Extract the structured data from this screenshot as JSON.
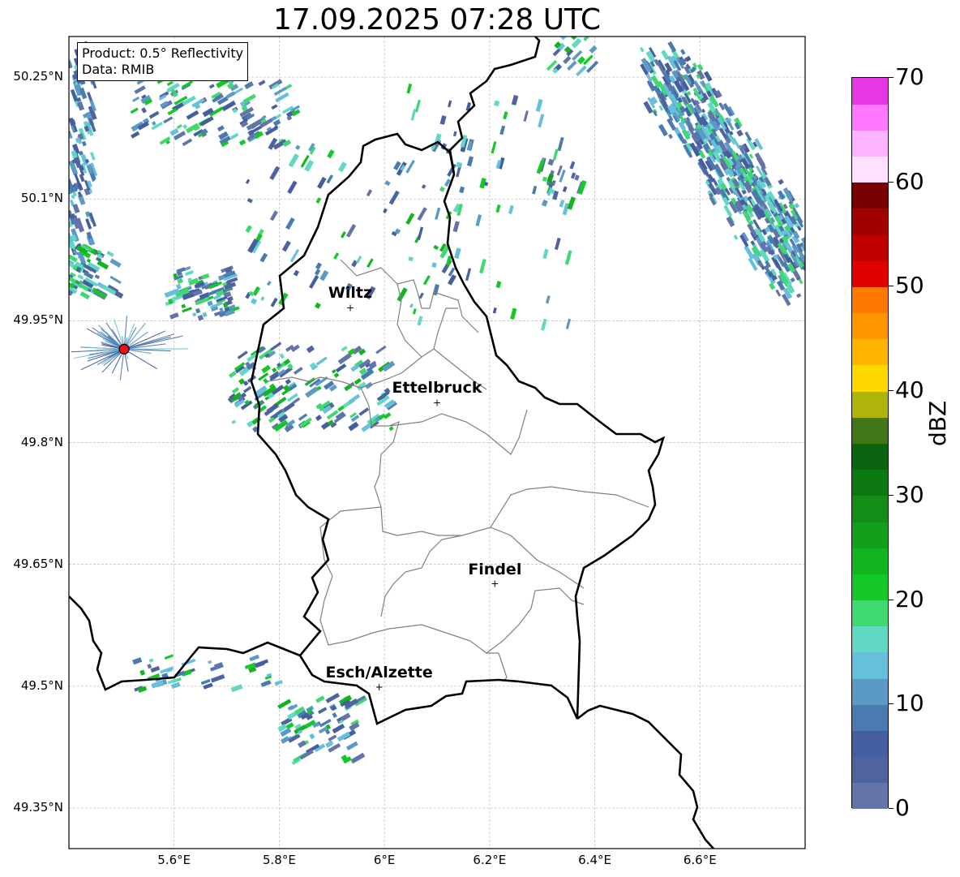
{
  "title": "17.09.2025 07:28 UTC",
  "info_box": {
    "product": "Product: 0.5° Reflectivity",
    "data": "Data: RMIB"
  },
  "latitude_ticks": [
    {
      "value": 50.25,
      "label": "50.25°N"
    },
    {
      "value": 50.1,
      "label": "50.1°N"
    },
    {
      "value": 49.95,
      "label": "49.95°N"
    },
    {
      "value": 49.8,
      "label": "49.8°N"
    },
    {
      "value": 49.65,
      "label": "49.65°N"
    },
    {
      "value": 49.5,
      "label": "49.5°N"
    },
    {
      "value": 49.35,
      "label": "49.35°N"
    }
  ],
  "longitude_ticks": [
    {
      "value": 5.6,
      "label": "5.6°E"
    },
    {
      "value": 5.8,
      "label": "5.8°E"
    },
    {
      "value": 6.0,
      "label": "6°E"
    },
    {
      "value": 6.2,
      "label": "6.2°E"
    },
    {
      "value": 6.4,
      "label": "6.4°E"
    },
    {
      "value": 6.6,
      "label": "6.6°E"
    }
  ],
  "extent": {
    "lon_min": 5.4,
    "lon_max": 6.8,
    "lat_min": 49.3,
    "lat_max": 50.3
  },
  "cities": [
    {
      "name": "Wiltz",
      "lon": 5.935,
      "lat": 49.967
    },
    {
      "name": "Ettelbruck",
      "lon": 6.1,
      "lat": 49.85
    },
    {
      "name": "Findel",
      "lon": 6.21,
      "lat": 49.627
    },
    {
      "name": "Esch/Alzette",
      "lon": 5.99,
      "lat": 49.5
    }
  ],
  "radar_site": {
    "lon": 5.505,
    "lat": 49.915
  },
  "colorbar": {
    "label": "dBZ",
    "ticks": [
      {
        "value": 0,
        "label": "0"
      },
      {
        "value": 10,
        "label": "10"
      },
      {
        "value": 20,
        "label": "20"
      },
      {
        "value": 30,
        "label": "30"
      },
      {
        "value": 40,
        "label": "40"
      },
      {
        "value": 50,
        "label": "50"
      },
      {
        "value": 60,
        "label": "60"
      },
      {
        "value": 70,
        "label": "70"
      }
    ],
    "min": 0,
    "max": 70,
    "colors": [
      "#6474a8",
      "#4f649e",
      "#445e9f",
      "#4a7ab0",
      "#5a9ac5",
      "#66c0dc",
      "#60d8c4",
      "#40d870",
      "#14c828",
      "#12b420",
      "#12a01c",
      "#148c18",
      "#0c7810",
      "#0a6410",
      "#427818",
      "#aeb40a",
      "#ffd800",
      "#ffb400",
      "#ff9600",
      "#ff7800",
      "#e00000",
      "#c00000",
      "#a00000",
      "#780000",
      "#ffe0ff",
      "#ffb4ff",
      "#ff78ff",
      "#e636e6"
    ]
  }
}
